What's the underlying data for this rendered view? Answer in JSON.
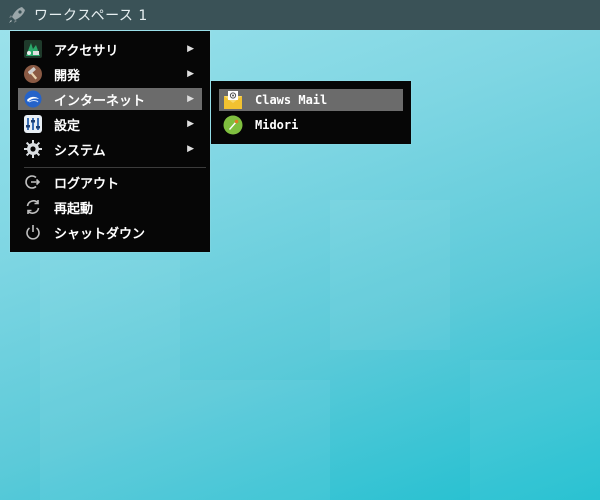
{
  "topbar": {
    "workspace_label": "ワークスペース 1",
    "launcher_icon": "rocket-icon"
  },
  "menu": {
    "items": [
      {
        "label": "アクセサリ",
        "icon": "accessories-icon",
        "has_submenu": true
      },
      {
        "label": "開発",
        "icon": "hammer-icon",
        "has_submenu": true
      },
      {
        "label": "インターネット",
        "icon": "globe-icon",
        "has_submenu": true,
        "active": true
      },
      {
        "label": "設定",
        "icon": "settings-icon",
        "has_submenu": true
      },
      {
        "label": "システム",
        "icon": "gear-icon",
        "has_submenu": true
      }
    ],
    "session": [
      {
        "label": "ログアウト",
        "icon": "logout-icon"
      },
      {
        "label": "再起動",
        "icon": "restart-icon"
      },
      {
        "label": "シャットダウン",
        "icon": "power-icon"
      }
    ],
    "arrow_glyph": "▶"
  },
  "submenu": {
    "items": [
      {
        "label": "Claws Mail",
        "icon": "mail-icon",
        "active": true
      },
      {
        "label": "Midori",
        "icon": "midori-icon"
      }
    ]
  },
  "colors": {
    "menu_bg": "#060606",
    "highlight": "#6b6b6b",
    "topbar_bg": "#3a5257",
    "desktop_light": "#9fe3ec",
    "desktop_dark": "#1ebfd0"
  }
}
